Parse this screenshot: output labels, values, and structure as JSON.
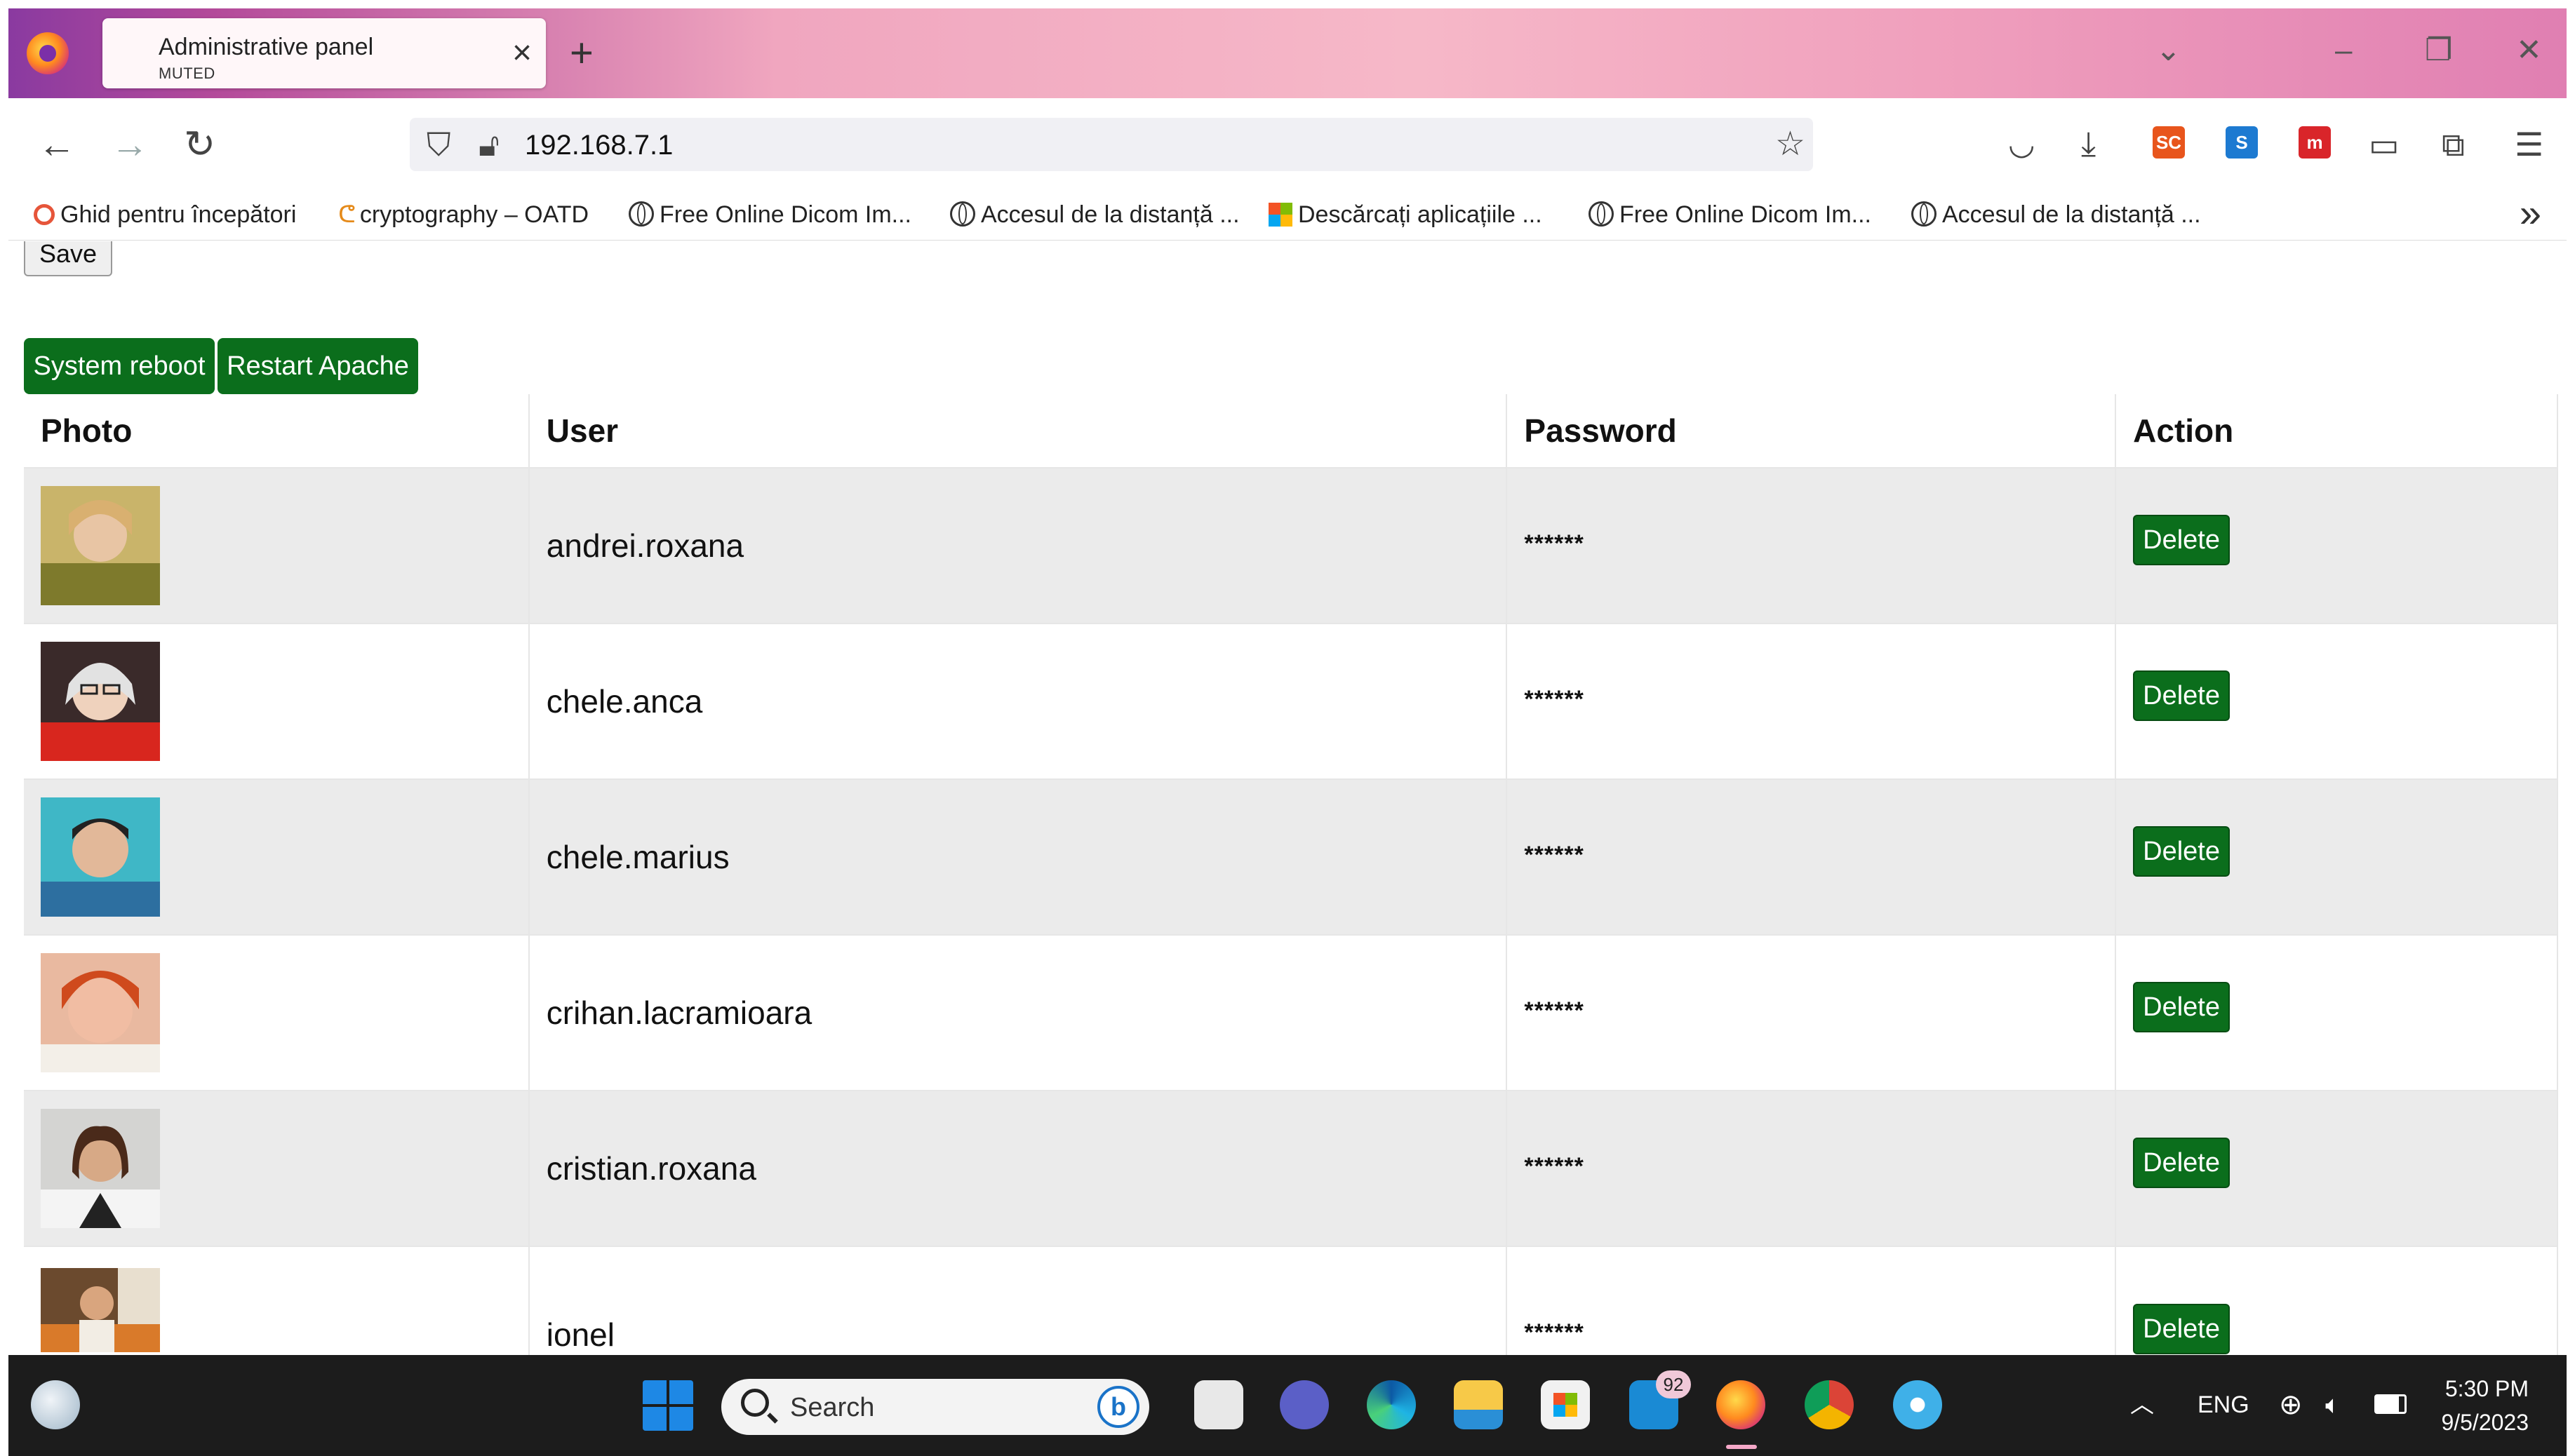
{
  "browser": {
    "tab": {
      "title": "Administrative panel",
      "subtitle": "MUTED"
    },
    "url": "192.168.7.1",
    "bookmarks": [
      "Ghid pentru începători",
      "cryptography – OATD",
      "Free Online Dicom Im...",
      "Accesul de la distanță ...",
      "Descărcați aplicațiile ...",
      "Free Online Dicom Im...",
      "Accesul de la distanță ..."
    ]
  },
  "page": {
    "save_label": "Save",
    "system_reboot_label": "System reboot",
    "restart_apache_label": "Restart Apache",
    "table": {
      "headers": [
        "Photo",
        "User",
        "Password",
        "Action"
      ],
      "rows": [
        {
          "user": "andrei.roxana",
          "password": "******",
          "action": "Delete"
        },
        {
          "user": "chele.anca",
          "password": "******",
          "action": "Delete"
        },
        {
          "user": "chele.marius",
          "password": "******",
          "action": "Delete"
        },
        {
          "user": "crihan.lacramioara",
          "password": "******",
          "action": "Delete"
        },
        {
          "user": "cristian.roxana",
          "password": "******",
          "action": "Delete"
        },
        {
          "user": "ionel",
          "password": "******",
          "action": "Delete"
        }
      ]
    }
  },
  "taskbar": {
    "search_placeholder": "Search",
    "mail_badge": "92",
    "language": "ENG",
    "time": "5:30 PM",
    "date": "9/5/2023"
  },
  "colors": {
    "action_green": "#0b6e1c",
    "row_alt": "#ebebeb"
  }
}
